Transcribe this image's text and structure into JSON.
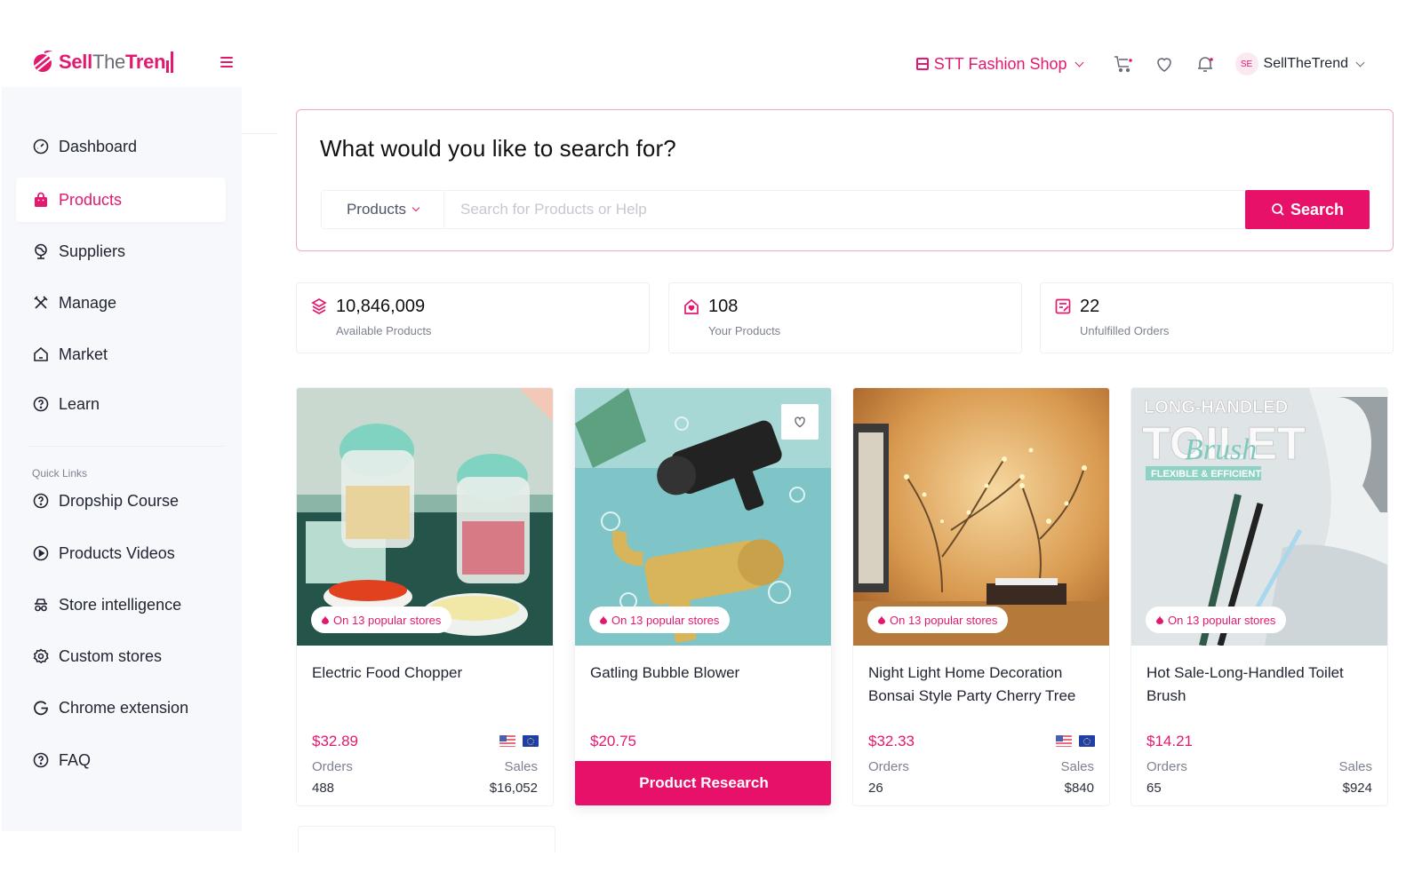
{
  "brand": {
    "name_part1": "Sell",
    "name_part2": "The",
    "name_part3": "Tren",
    "accent_color": "#e3186f",
    "button_color": "#e8116a"
  },
  "header": {
    "shop_name": "STT Fashion Shop",
    "icons": [
      "cart-icon",
      "heart-icon",
      "bell-icon"
    ],
    "user": {
      "initials": "SE",
      "name": "SellTheTrend"
    }
  },
  "sidebar": {
    "items": [
      {
        "label": "Dashboard",
        "icon": "dashboard-gauge-icon",
        "active": false
      },
      {
        "label": "Products",
        "icon": "shopping-bag-icon",
        "active": true
      },
      {
        "label": "Suppliers",
        "icon": "globe-icon",
        "active": false
      },
      {
        "label": "Manage",
        "icon": "tools-icon",
        "active": false
      },
      {
        "label": "Market",
        "icon": "home-icon",
        "active": false
      },
      {
        "label": "Learn",
        "icon": "question-circle-icon",
        "active": false
      }
    ],
    "quick_links_title": "Quick Links",
    "quick_links": [
      {
        "label": "Dropship Course",
        "icon": "question-circle-icon"
      },
      {
        "label": "Products Videos",
        "icon": "play-circle-icon"
      },
      {
        "label": "Store intelligence",
        "icon": "spy-icon"
      },
      {
        "label": "Custom stores",
        "icon": "gear-icon"
      },
      {
        "label": "Chrome extension",
        "icon": "google-icon"
      },
      {
        "label": "FAQ",
        "icon": "question-circle-icon"
      }
    ]
  },
  "search": {
    "title": "What would you like to search for?",
    "scope": "Products",
    "placeholder": "Search for Products or Help",
    "value": "",
    "button_label": "Search"
  },
  "stats": [
    {
      "value": "10,846,009",
      "label": "Available Products",
      "icon": "layers-icon"
    },
    {
      "value": "108",
      "label": "Your Products",
      "icon": "store-heart-icon"
    },
    {
      "value": "22",
      "label": "Unfulfilled Orders",
      "icon": "edit-list-icon"
    }
  ],
  "products": [
    {
      "title": "Electric Food Chopper",
      "badge": "On 13 popular stores",
      "price": "$32.89",
      "flags": [
        "us",
        "eu"
      ],
      "orders_label": "Orders",
      "orders": "488",
      "sales_label": "Sales",
      "sales": "$16,052"
    },
    {
      "title": "Gatling Bubble Blower",
      "badge": "On 13 popular stores",
      "price": "$20.75",
      "flags": [],
      "hovered": true,
      "action_label": "Product Research"
    },
    {
      "title": "Night Light Home Decoration Bonsai Style Party Cherry Tree",
      "badge": "On 13 popular stores",
      "price": "$32.33",
      "flags": [
        "us",
        "eu"
      ],
      "orders_label": "Orders",
      "orders": "26",
      "sales_label": "Sales",
      "sales": "$840"
    },
    {
      "title": "Hot Sale-Long-Handled Toilet Brush",
      "badge": "On 13 popular stores",
      "price": "$14.21",
      "flags": [],
      "image_text": [
        "LONG-HANDLED",
        "TOILET",
        "Brush",
        "FLEXIBLE & EFFICIENT"
      ],
      "orders_label": "Orders",
      "orders": "65",
      "sales_label": "Sales",
      "sales": "$924"
    }
  ]
}
